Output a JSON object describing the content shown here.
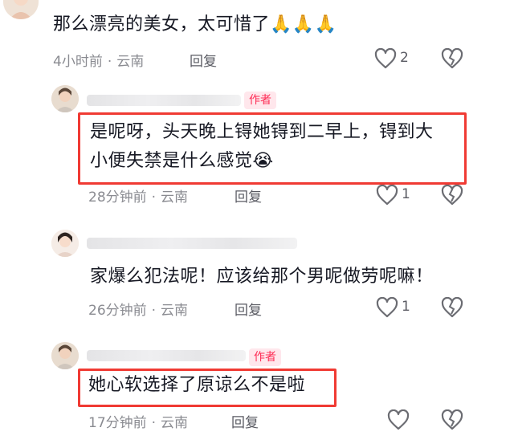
{
  "colors": {
    "accent": "#fe2c55",
    "highlight_border": "#f03a33",
    "meta": "#8a8b91",
    "text": "#161823"
  },
  "comments": [
    {
      "text": "那么漂亮的美女，太可惜了🙏🙏🙏",
      "time": "4小时前",
      "location": "云南",
      "reply": "回复",
      "likes": "2"
    },
    {
      "author_badge": "作者",
      "text_line1": "是呢呀，头天晚上锝她锝到二早上，锝到大",
      "text_line2": "小便失禁是什么感觉😭",
      "time": "28分钟前",
      "location": "云南",
      "reply": "回复",
      "likes": "1"
    },
    {
      "text": "家爆么犯法呢！应该给那个男呢做劳呢嘛！",
      "time": "26分钟前",
      "location": "云南",
      "reply": "回复",
      "likes": "1"
    },
    {
      "author_badge": "作者",
      "text": "她心软选择了原谅么不是啦",
      "time": "17分钟前",
      "location": "云南",
      "reply": "回复"
    }
  ],
  "separator": "·",
  "icons": [
    "heart-icon",
    "dislike-broken-heart-icon"
  ]
}
